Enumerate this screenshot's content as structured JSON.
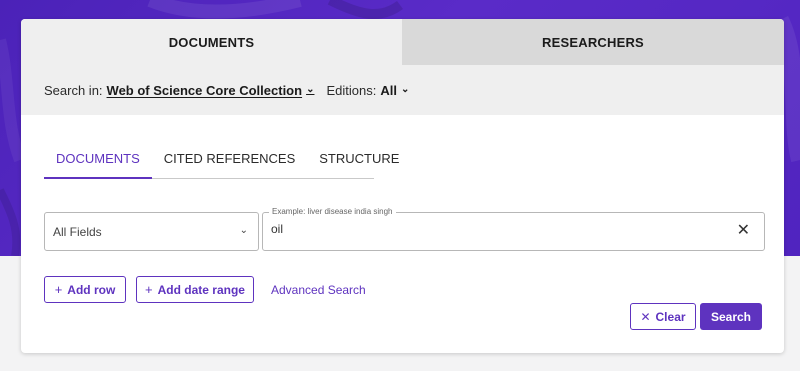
{
  "top_tabs": [
    {
      "label": "DOCUMENTS",
      "active": true
    },
    {
      "label": "RESEARCHERS",
      "active": false
    }
  ],
  "search_in": {
    "label": "Search in:",
    "value": "Web of Science Core Collection",
    "editions_label": "Editions:",
    "editions_value": "All"
  },
  "inner_tabs": [
    {
      "label": "DOCUMENTS",
      "active": true
    },
    {
      "label": "CITED REFERENCES",
      "active": false
    },
    {
      "label": "STRUCTURE",
      "active": false
    }
  ],
  "query_row": {
    "field_select": "All Fields",
    "placeholder": "Example: liver disease india singh",
    "value": "oil"
  },
  "actions": {
    "add_row": "Add row",
    "add_date_range": "Add date range",
    "advanced_search": "Advanced Search",
    "clear": "Clear",
    "search": "Search"
  },
  "icons": {
    "chevron": "chevron-down-icon",
    "close": "close-icon",
    "plus": "plus-icon"
  },
  "colors": {
    "brand_purple": "#5e33bf",
    "background_purple": "#4b22b8"
  }
}
